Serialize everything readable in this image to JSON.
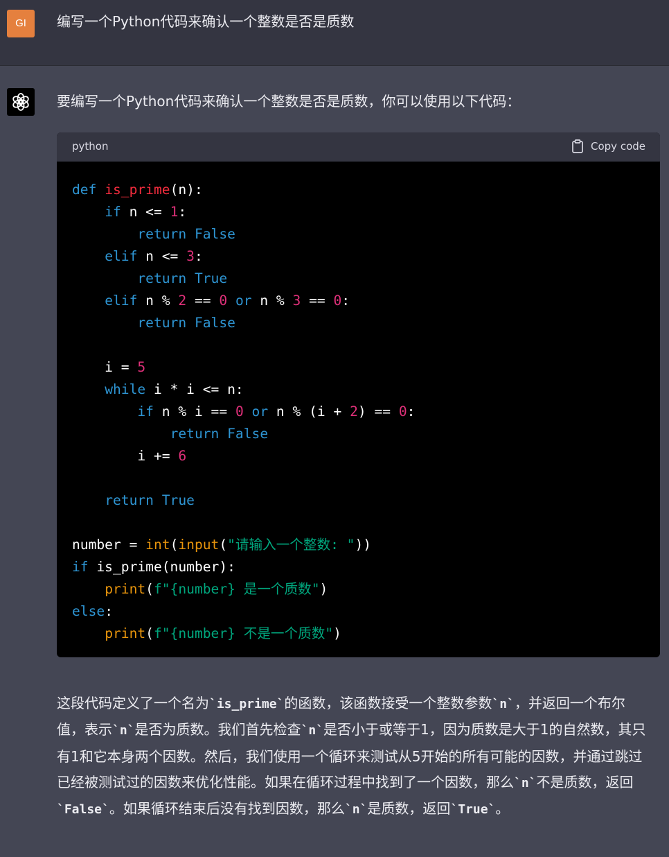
{
  "user": {
    "avatar_initials": "GI",
    "message": "编写一个Python代码来确认一个整数是否是质数"
  },
  "assistant": {
    "intro": "要编写一个Python代码来确认一个整数是否是质数，你可以使用以下代码：",
    "code_block": {
      "language": "python",
      "copy_label": "Copy code",
      "lines": [
        "def is_prime(n):",
        "    if n <= 1:",
        "        return False",
        "    elif n <= 3:",
        "        return True",
        "    elif n % 2 == 0 or n % 3 == 0:",
        "        return False",
        "",
        "    i = 5",
        "    while i * i <= n:",
        "        if n % i == 0 or n % (i + 2) == 0:",
        "            return False",
        "        i += 6",
        "",
        "    return True",
        "",
        "number = int(input(\"请输入一个整数: \"))",
        "if is_prime(number):",
        "    print(f\"{number} 是一个质数\")",
        "else:",
        "    print(f\"{number} 不是一个质数\")"
      ]
    },
    "explanation": {
      "p1": "这段代码定义了一个名为",
      "c1": "`is_prime`",
      "p2": "的函数，该函数接受一个整数参数",
      "c2": "`n`",
      "p3": "，并返回一个布尔值，表示",
      "c3": "`n`",
      "p4": "是否为质数。我们首先检查",
      "c4": "`n`",
      "p5": "是否小于或等于1，因为质数是大于1的自然数，其只有1和它本身两个因数。然后，我们使用一个循环来测试从5开始的所有可能的因数，并通过跳过已经被测试过的因数来优化性能。如果在循环过程中找到了一个因数，那么",
      "c5": "`n`",
      "p6": "不是质数，返回",
      "c6": "`False`",
      "p7": "。如果循环结束后没有找到因数，那么",
      "c7": "`n`",
      "p8": "是质数，返回",
      "c8": "`True`",
      "p9": "。"
    }
  },
  "colors": {
    "user_bg": "#343541",
    "assistant_bg": "#444654",
    "code_bg": "#000000",
    "keyword": "#2e95d3",
    "function": "#f22c3d",
    "number": "#df3079",
    "builtin": "#e9950c",
    "string": "#00a67d"
  },
  "icons": {
    "bot_avatar": "openai-logo-icon",
    "copy": "clipboard-icon"
  }
}
